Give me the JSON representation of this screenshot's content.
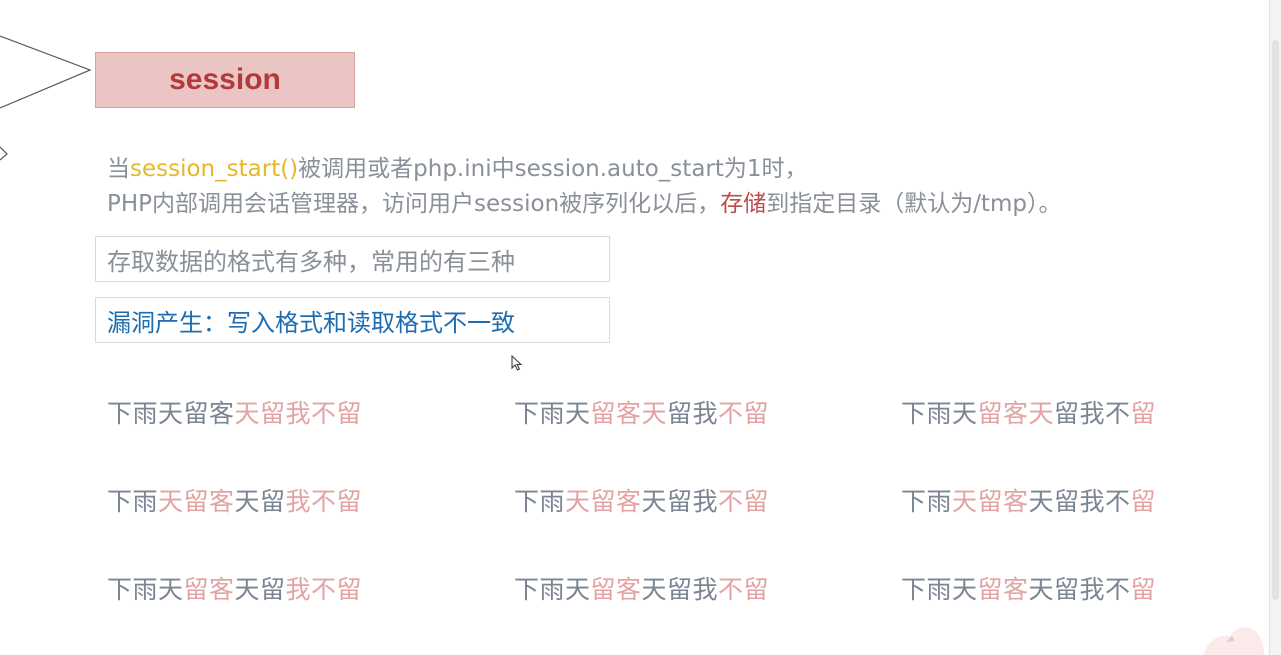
{
  "title": {
    "label": "session"
  },
  "description": {
    "line1": [
      {
        "text": "当",
        "style": "normal"
      },
      {
        "text": "session_start()",
        "style": "yellow"
      },
      {
        "text": "被调用或者php.ini中session.auto_start为1时，",
        "style": "normal"
      }
    ],
    "line2": [
      {
        "text": "PHP内部调用会话管理器，访问用户session被序列化以后，",
        "style": "normal"
      },
      {
        "text": "存储",
        "style": "red"
      },
      {
        "text": "到指定目录（默认为/tmp）。",
        "style": "normal"
      }
    ]
  },
  "boxes": {
    "formats": "存取数据的格式有多种，常用的有三种",
    "vulnerability": "漏洞产生：写入格式和读取格式不一致"
  },
  "colors": {
    "accent_red": "#b23a3a",
    "title_bg": "#ebc4c4",
    "highlight_yellow": "#e5b829",
    "link_blue": "#1f6db1",
    "text_grey": "#7b8593",
    "text_pink": "#e3a3a3"
  },
  "phrase_grid": [
    [
      [
        {
          "t": "下雨天留客",
          "c": "grey"
        },
        {
          "t": "天留我不留",
          "c": "pink"
        }
      ],
      [
        {
          "t": "下雨天",
          "c": "grey"
        },
        {
          "t": "留客天",
          "c": "pink"
        },
        {
          "t": "留我",
          "c": "grey"
        },
        {
          "t": "不留",
          "c": "pink"
        }
      ],
      [
        {
          "t": "下雨天",
          "c": "grey"
        },
        {
          "t": "留客天",
          "c": "pink"
        },
        {
          "t": "留我不",
          "c": "grey"
        },
        {
          "t": "留",
          "c": "pink"
        }
      ]
    ],
    [
      [
        {
          "t": "下雨",
          "c": "grey"
        },
        {
          "t": "天留客",
          "c": "pink"
        },
        {
          "t": "天留",
          "c": "grey"
        },
        {
          "t": "我不留",
          "c": "pink"
        }
      ],
      [
        {
          "t": "下雨",
          "c": "grey"
        },
        {
          "t": "天留客",
          "c": "pink"
        },
        {
          "t": "天留我",
          "c": "grey"
        },
        {
          "t": "不留",
          "c": "pink"
        }
      ],
      [
        {
          "t": "下雨",
          "c": "grey"
        },
        {
          "t": "天留客",
          "c": "pink"
        },
        {
          "t": "天留我不",
          "c": "grey"
        },
        {
          "t": "留",
          "c": "pink"
        }
      ]
    ],
    [
      [
        {
          "t": "下雨天",
          "c": "grey"
        },
        {
          "t": "留客",
          "c": "pink"
        },
        {
          "t": "天留",
          "c": "grey"
        },
        {
          "t": "我不留",
          "c": "pink"
        }
      ],
      [
        {
          "t": "下雨天",
          "c": "grey"
        },
        {
          "t": "留客",
          "c": "pink"
        },
        {
          "t": "天留我",
          "c": "grey"
        },
        {
          "t": "不留",
          "c": "pink"
        }
      ],
      [
        {
          "t": "下雨天",
          "c": "grey"
        },
        {
          "t": "留客",
          "c": "pink"
        },
        {
          "t": "天留我不",
          "c": "grey"
        },
        {
          "t": "留",
          "c": "pink"
        }
      ]
    ]
  ]
}
